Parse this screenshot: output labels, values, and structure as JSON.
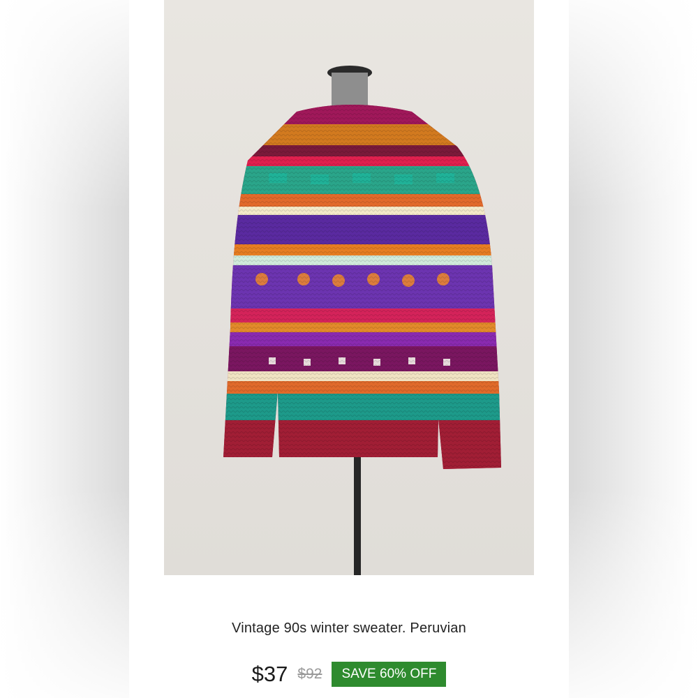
{
  "listing": {
    "title": "Vintage 90s winter sweater. Peruvian",
    "price": "$37",
    "original_price": "$92",
    "discount_badge": "SAVE 60% OFF"
  },
  "colors": {
    "badge": "#2e8b2e",
    "sweater_main": "#9a1f4a",
    "sweater_ribbing": "#a11e35",
    "wall": "#e7e4df"
  }
}
